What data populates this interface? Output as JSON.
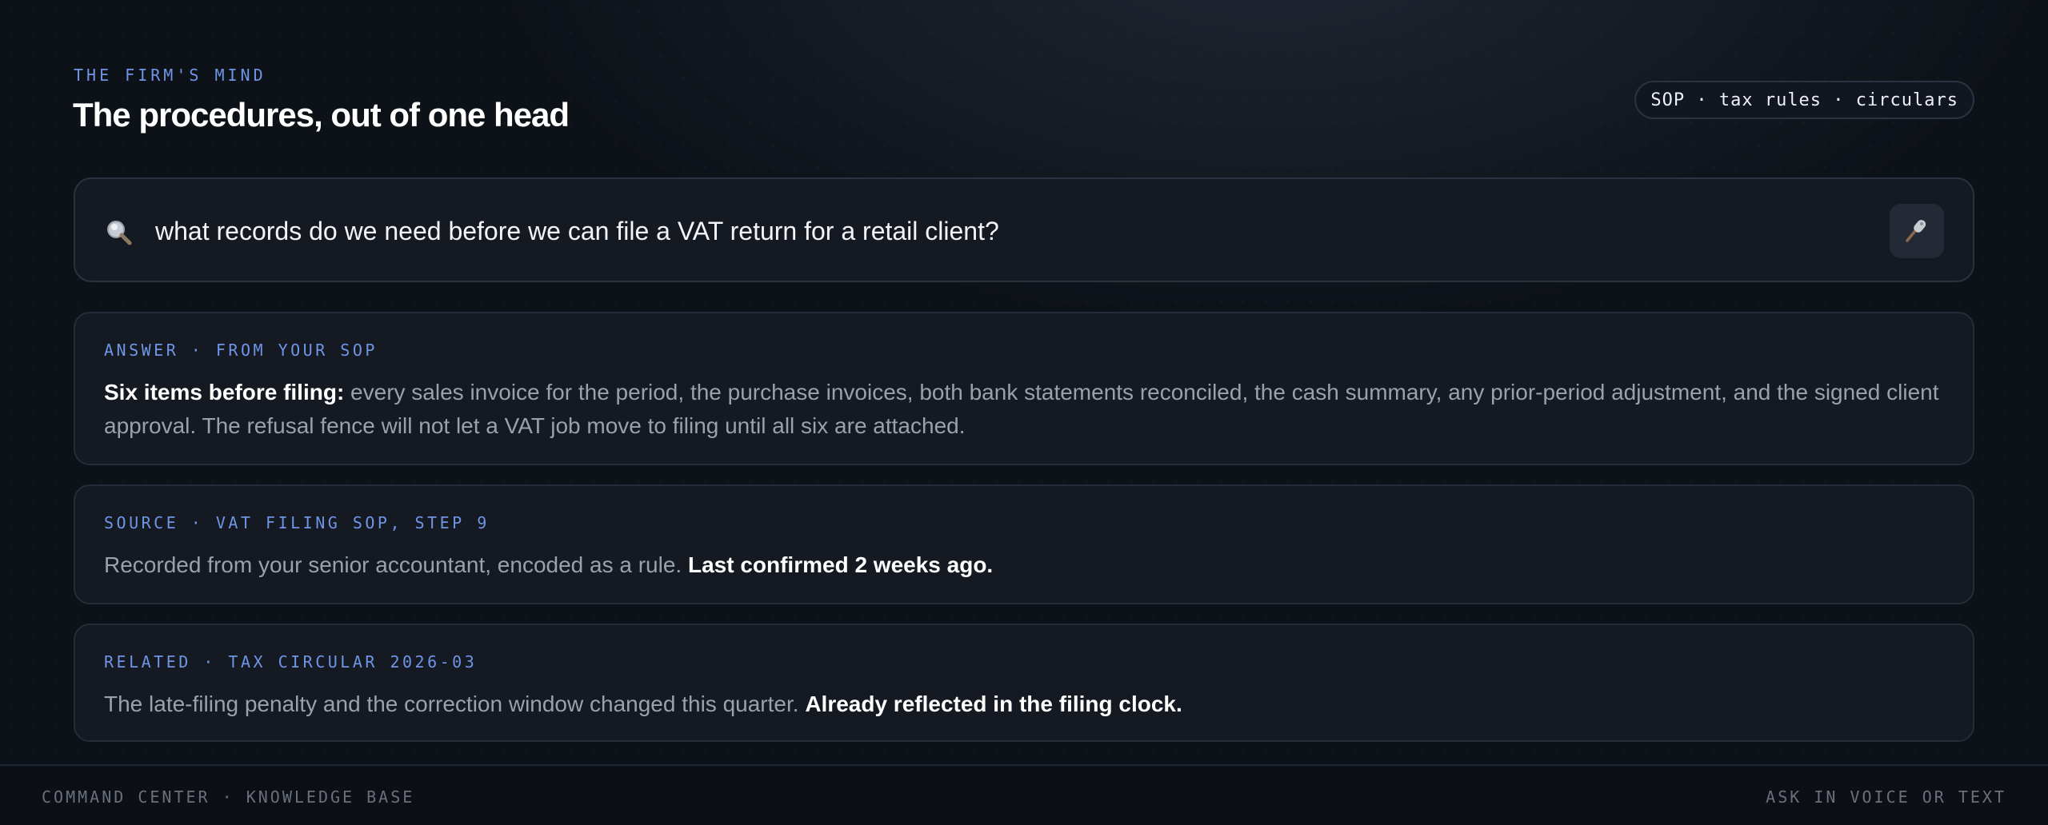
{
  "header": {
    "eyebrow": "THE FIRM'S MIND",
    "title": "The procedures, out of one head",
    "scope_pill": "SOP · tax rules · circulars"
  },
  "search": {
    "query": "what records do we need before we can file a VAT return for a retail client?",
    "search_icon": "search-icon",
    "mic_icon": "microphone-icon"
  },
  "cards": {
    "answer": {
      "label": "ANSWER · FROM YOUR SOP",
      "lead": "Six items before filing:",
      "text": " every sales invoice for the period, the purchase invoices, both bank statements reconciled, the cash summary, any prior-period adjustment, and the signed client approval. The refusal fence will not let a VAT job move to filing until all six are attached."
    },
    "source": {
      "label": "SOURCE · VAT FILING SOP, STEP 9",
      "text": "Recorded from your senior accountant, encoded as a rule. ",
      "emphasis": "Last confirmed 2 weeks ago."
    },
    "related": {
      "label": "RELATED · TAX CIRCULAR 2026-03",
      "text": "The late-filing penalty and the correction window changed this quarter. ",
      "emphasis": "Already reflected in the filing clock."
    }
  },
  "footer": {
    "left": "COMMAND CENTER · KNOWLEDGE BASE",
    "right": "ASK IN VOICE OR TEXT"
  },
  "colors": {
    "accent": "#6f95e6",
    "background": "#0d1118",
    "card": "#141922"
  }
}
